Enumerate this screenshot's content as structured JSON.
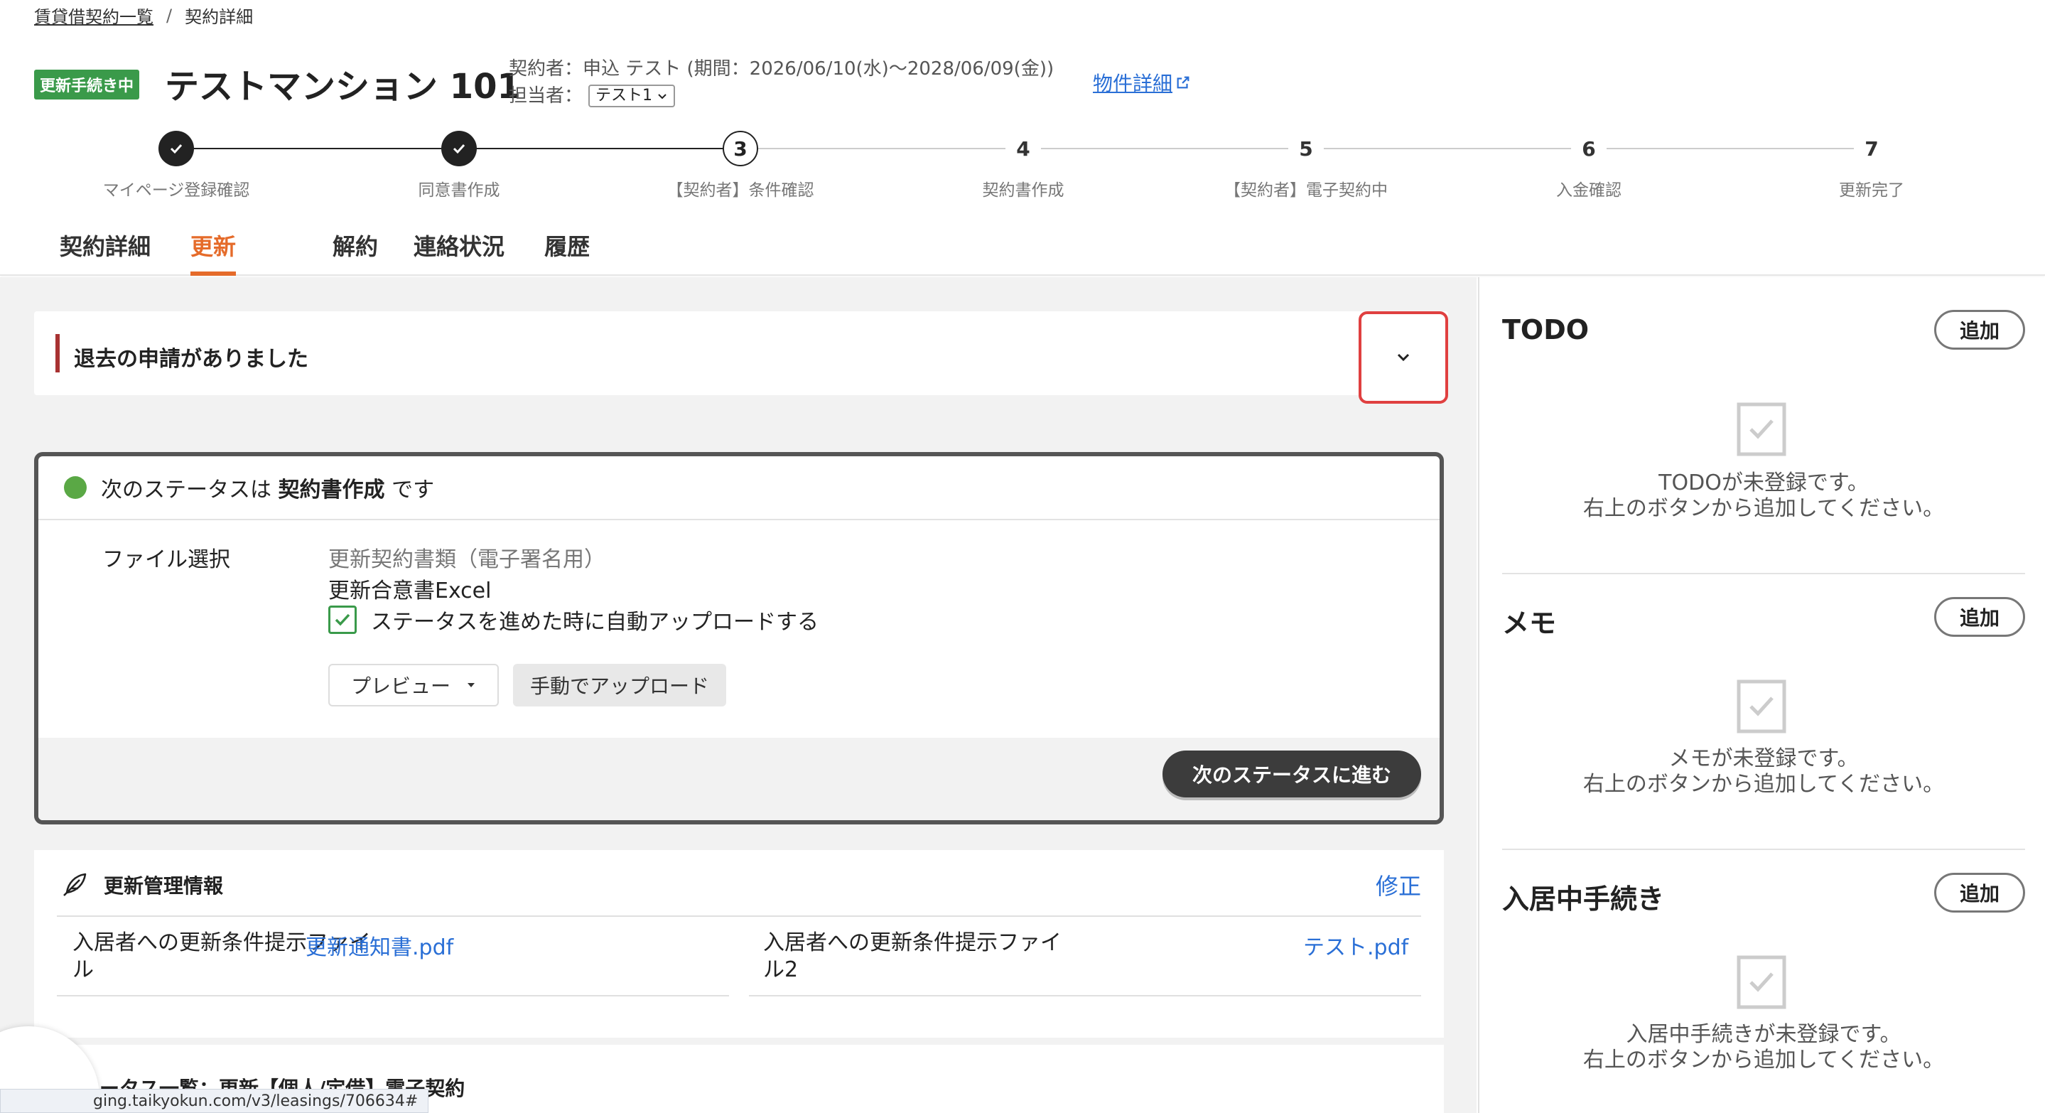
{
  "breadcrumb": {
    "root": "賃貸借契約一覧",
    "separator": "/",
    "current": "契約詳細"
  },
  "header": {
    "status_badge": "更新手続き中",
    "title": "テストマンション 101",
    "contract_info": "契約者：申込 テスト (期間：2026/06/10(水)〜2028/06/09(金))",
    "assignee_label": "担当者：",
    "assignee_value": "テスト1",
    "property_link": "物件詳細"
  },
  "stepper": [
    {
      "number": "",
      "label": "マイページ登録確認",
      "state": "done"
    },
    {
      "number": "",
      "label": "同意書作成",
      "state": "done"
    },
    {
      "number": "3",
      "label": "【契約者】条件確認",
      "state": "current"
    },
    {
      "number": "4",
      "label": "契約書作成",
      "state": "todo"
    },
    {
      "number": "5",
      "label": "【契約者】電子契約中",
      "state": "todo"
    },
    {
      "number": "6",
      "label": "入金確認",
      "state": "todo"
    },
    {
      "number": "7",
      "label": "更新完了",
      "state": "todo"
    }
  ],
  "tabs": [
    {
      "label": "契約詳細",
      "active": false
    },
    {
      "label": "更新",
      "active": true
    },
    {
      "label": "解約",
      "active": false
    },
    {
      "label": "連絡状況",
      "active": false
    },
    {
      "label": "履歴",
      "active": false
    }
  ],
  "alert": {
    "text": "退去の申請がありました"
  },
  "status_card": {
    "prefix": "次のステータスは",
    "status": "契約書作成",
    "suffix": "です",
    "file_label": "ファイル選択",
    "file_type": "更新契約書類（電子署名用）",
    "file_name": "更新合意書Excel",
    "auto_upload_label": "ステータスを進めた時に自動アップロードする",
    "preview_button": "プレビュー",
    "manual_upload_button": "手動でアップロード",
    "next_button": "次のステータスに進む"
  },
  "renewal_info": {
    "title": "更新管理情報",
    "edit": "修正",
    "row1_label_line1": "入居者への更新条件提示ファイ",
    "row1_label_line2": "ル",
    "row1_file": "更新通知書.pdf",
    "row2_label_line1": "入居者への更新条件提示ファイ",
    "row2_label_line2": "ル2",
    "row2_file": "テスト.pdf"
  },
  "status_list": {
    "title": "ータス一覧：更新【個人/定借】電子契約"
  },
  "url_tooltip": "ging.taikyokun.com/v3/leasings/706634#",
  "right_panel": {
    "todo": {
      "title": "TODO",
      "add": "追加",
      "empty_line1": "TODOが未登録です。",
      "empty_line2": "右上のボタンから追加してください。"
    },
    "memo": {
      "title": "メモ",
      "add": "追加",
      "empty_line1": "メモが未登録です。",
      "empty_line2": "右上のボタンから追加してください。"
    },
    "procedures": {
      "title": "入居中手続き",
      "add": "追加",
      "empty_line1": "入居中手続きが未登録です。",
      "empty_line2": "右上のボタンから追加してください。"
    }
  },
  "colors": {
    "accent_orange": "#e56b2a",
    "badge_green": "#3a9a4a",
    "link_blue": "#2a6fd6",
    "alert_red": "#a83232"
  }
}
